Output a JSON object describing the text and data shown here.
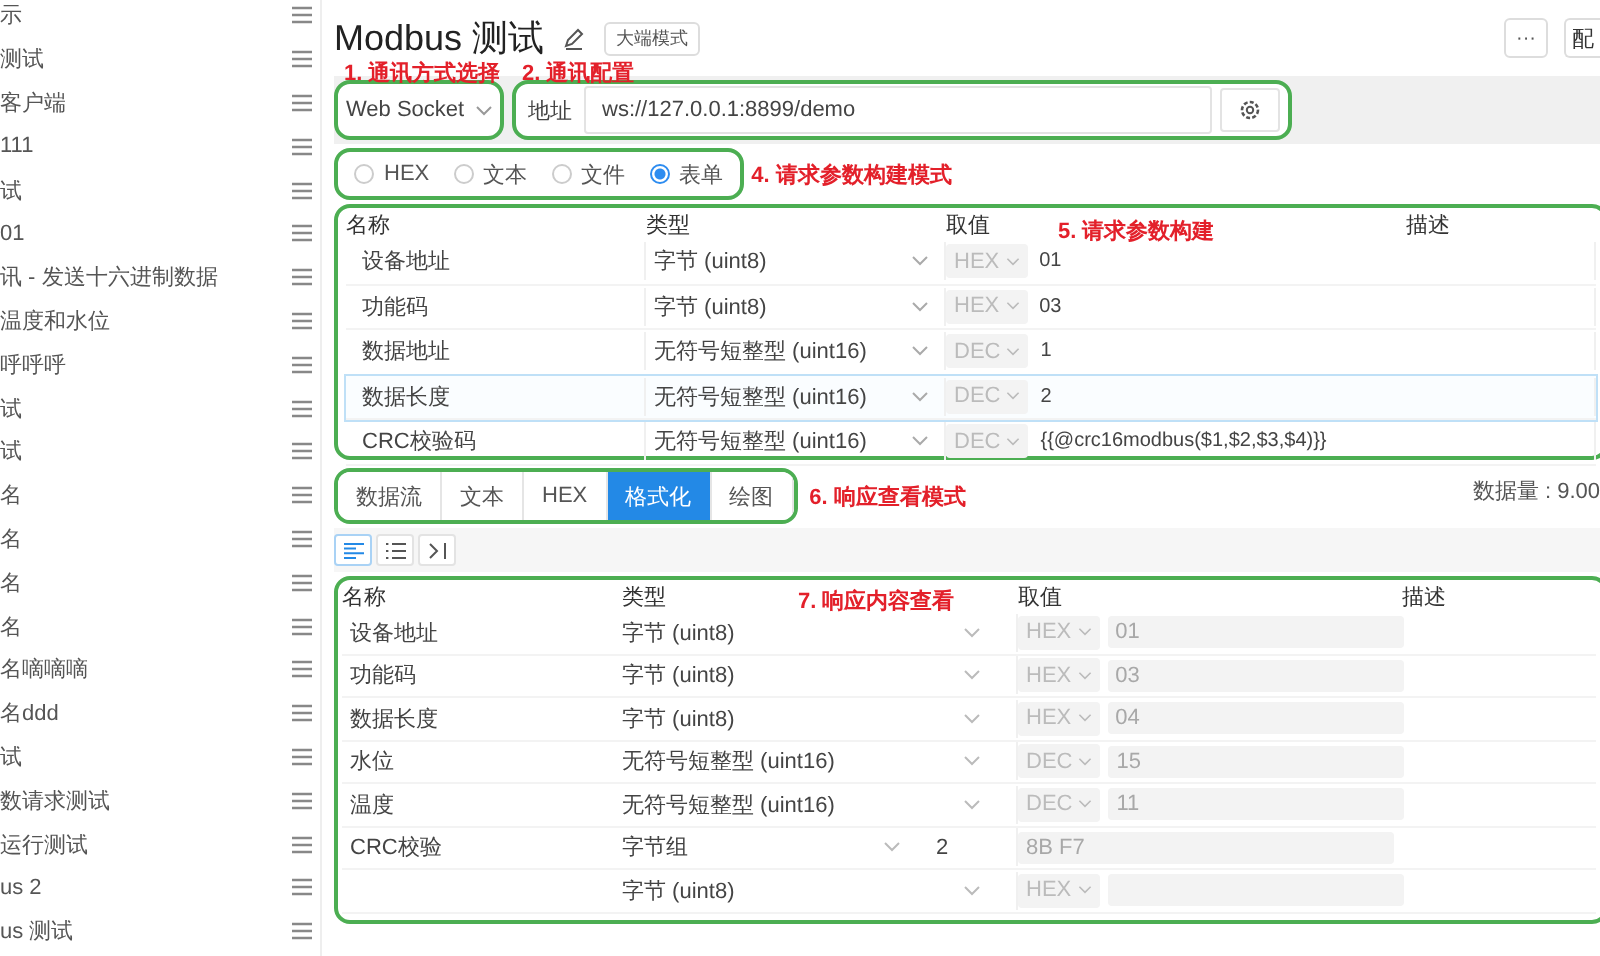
{
  "sidebar": {
    "items": [
      {
        "label": "示"
      },
      {
        "label": "测试"
      },
      {
        "label": "客户端"
      },
      {
        "label": "111"
      },
      {
        "label": "试"
      },
      {
        "label": "01"
      },
      {
        "label": "讯 - 发送十六进制数据"
      },
      {
        "label": "温度和水位"
      },
      {
        "label": "呼呼呼"
      },
      {
        "label": "试"
      },
      {
        "label": "试"
      },
      {
        "label": "名"
      },
      {
        "label": "名"
      },
      {
        "label": "名"
      },
      {
        "label": "名"
      },
      {
        "label": "名嘀嘀嘀"
      },
      {
        "label": "名ddd"
      },
      {
        "label": "试"
      },
      {
        "label": "数请求测试"
      },
      {
        "label": "运行测试"
      },
      {
        "label": "us 2"
      },
      {
        "label": "us 测试"
      }
    ]
  },
  "header": {
    "title": "Modbus 测试",
    "tag": "大端模式",
    "more": "···",
    "button": "配"
  },
  "connection": {
    "method": "Web Socket",
    "method_annotation": "1. 通讯方式选择",
    "address_label": "地址",
    "address": "ws://127.0.0.1:8899/demo",
    "config_annotation": "2. 通讯配置"
  },
  "request_mode": {
    "annotation": "4. 请求参数构建模式",
    "options": [
      {
        "label": "HEX",
        "selected": false
      },
      {
        "label": "文本",
        "selected": false
      },
      {
        "label": "文件",
        "selected": false
      },
      {
        "label": "表单",
        "selected": true
      }
    ]
  },
  "request_table": {
    "annotation": "5. 请求参数构建",
    "columns": [
      "名称",
      "类型",
      "取值",
      "描述"
    ],
    "rows": [
      {
        "name": "设备地址",
        "type": "字节 (uint8)",
        "format": "HEX",
        "value": "01",
        "selected": false
      },
      {
        "name": "功能码",
        "type": "字节 (uint8)",
        "format": "HEX",
        "value": "03",
        "selected": false
      },
      {
        "name": "数据地址",
        "type": "无符号短整型 (uint16)",
        "format": "DEC",
        "value": "1",
        "selected": false
      },
      {
        "name": "数据长度",
        "type": "无符号短整型 (uint16)",
        "format": "DEC",
        "value": "2",
        "selected": true
      },
      {
        "name": "CRC校验码",
        "type": "无符号短整型 (uint16)",
        "format": "DEC",
        "value": "{{@crc16modbus($1,$2,$3,$4)}}",
        "selected": false
      }
    ]
  },
  "response_tabs": {
    "annotation": "6. 响应查看模式",
    "data_size": "数据量 : 9.00",
    "tabs": [
      {
        "label": "数据流",
        "selected": false
      },
      {
        "label": "文本",
        "selected": false
      },
      {
        "label": "HEX",
        "selected": false
      },
      {
        "label": "格式化",
        "selected": true
      },
      {
        "label": "绘图",
        "selected": false
      }
    ]
  },
  "view_toolbar": {
    "buttons": [
      {
        "kind": "align-left",
        "selected": true
      },
      {
        "kind": "list",
        "selected": false
      },
      {
        "kind": "collapse",
        "selected": false
      }
    ]
  },
  "response_table": {
    "annotation": "7. 响应内容查看",
    "columns": [
      "名称",
      "类型",
      "取值",
      "描述"
    ],
    "rows": [
      {
        "kind": "scalar",
        "name": "设备地址",
        "type": "字节 (uint8)",
        "format": "HEX",
        "value": "01"
      },
      {
        "kind": "scalar",
        "name": "功能码",
        "type": "字节 (uint8)",
        "format": "HEX",
        "value": "03"
      },
      {
        "kind": "scalar",
        "name": "数据长度",
        "type": "字节 (uint8)",
        "format": "HEX",
        "value": "04"
      },
      {
        "kind": "scalar",
        "name": "水位",
        "type": "无符号短整型 (uint16)",
        "format": "DEC",
        "value": "15"
      },
      {
        "kind": "scalar",
        "name": "温度",
        "type": "无符号短整型 (uint16)",
        "format": "DEC",
        "value": "11"
      },
      {
        "kind": "bytes",
        "name": "CRC校验",
        "type": "字节组",
        "count": "2",
        "hex_bytes": "8B F7"
      },
      {
        "kind": "scalar",
        "type": "字节 (uint8)",
        "format": "HEX"
      }
    ]
  }
}
